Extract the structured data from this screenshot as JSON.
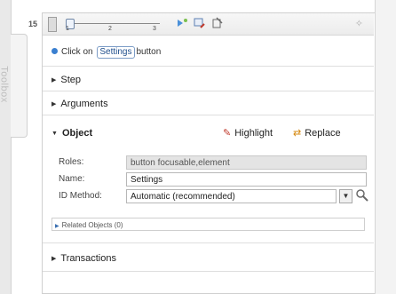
{
  "side": {
    "toolbox_label": "Toolbox",
    "step_number": "15"
  },
  "toolbar": {
    "slider_ticks": [
      "1",
      "2",
      "3"
    ],
    "pin_glyph": "✧"
  },
  "instruction": {
    "prefix": "Click on",
    "target": "Settings",
    "suffix": "button"
  },
  "sections": {
    "step": "Step",
    "arguments": "Arguments",
    "object": "Object",
    "transactions": "Transactions"
  },
  "object_actions": {
    "highlight": "Highlight",
    "replace": "Replace"
  },
  "object_props": {
    "roles_label": "Roles:",
    "roles_value": "button focusable,element",
    "name_label": "Name:",
    "name_value": "Settings",
    "id_method_label": "ID Method:",
    "id_method_value": "Automatic (recommended)"
  },
  "related_objects": "Related Objects (0)",
  "colors": {
    "accent": "#3a7fd0",
    "link_border": "#7d9dc7"
  }
}
